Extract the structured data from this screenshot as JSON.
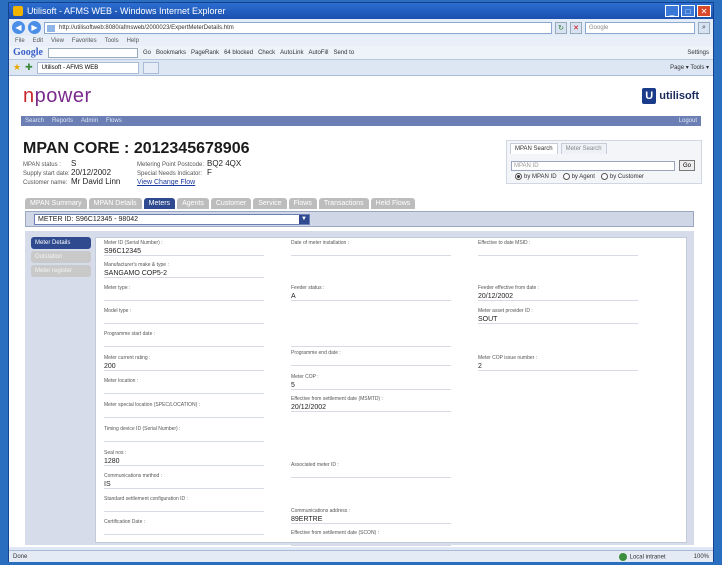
{
  "browser": {
    "title": "Utilisoft - AFMS WEB - Windows Internet Explorer",
    "url": "http://utilisoftweb:8080/afmsweb/2000023/ExpertMeterDetails.htm",
    "live_search_placeholder": "Google",
    "menus": [
      "File",
      "Edit",
      "View",
      "Favorites",
      "Tools",
      "Help"
    ],
    "google_label": "Google",
    "google_items": [
      "Go",
      "Bookmarks",
      "PageRank",
      "64 blocked",
      "Check",
      "AutoLink",
      "AutoFill",
      "Send to"
    ],
    "settings_label": "Settings",
    "tab_label": "Utilisoft - AFMS WEB",
    "toolbar_right": "Page ▾   Tools ▾",
    "status_left": "Done",
    "status_zone": "Local intranet",
    "status_zoom": "100%"
  },
  "brand": {
    "name_left": "n",
    "name_right": "power",
    "partner": "utilisoft",
    "partner_initial": "U"
  },
  "appnav": {
    "items": [
      "Search",
      "Reports",
      "Admin",
      "Flows"
    ],
    "logout": "Logout"
  },
  "mpan": {
    "title": "MPAN CORE : 2012345678906",
    "status_label": "MPAN status :",
    "status_value": "S",
    "supply_label": "Supply start date:",
    "supply_value": "20/12/2002",
    "customer_label": "Customer name:",
    "customer_value": "Mr David Linn",
    "mp_address_label": "Metering Point Postcode:",
    "mp_address_value": "BQ2 4QX",
    "special_label": "Special Needs Indicator:",
    "special_value": "F",
    "change_link": "View Change Flow"
  },
  "search": {
    "tab_active": "MPAN Search",
    "tab_other": "Meter Search",
    "placeholder": "MPAN ID",
    "go": "Go",
    "radio1": "by MPAN ID",
    "radio2": "by Agent",
    "radio3": "by Customer"
  },
  "tabs": [
    "MPAN Summary",
    "MPAN Details",
    "Meters",
    "Agents",
    "Customer",
    "Service",
    "Flows",
    "Transactions",
    "Held Flows"
  ],
  "active_tab_index": 2,
  "meter_select": "METER ID: S96C12345 - 98042",
  "side": {
    "items": [
      "Meter Details",
      "Outstation",
      "Meter register"
    ]
  },
  "fields": {
    "col1": [
      {
        "label": "Meter ID (Serial Number) :",
        "value": "S96C12345"
      },
      {
        "label": "Manufacturer's make & type :",
        "value": "SANGAMO COP5-2"
      },
      {
        "label": "Meter type :",
        "value": ""
      },
      {
        "label": "Model type :",
        "value": ""
      },
      {
        "label": "Programme start date :",
        "value": ""
      },
      {
        "label": "Meter current rating :",
        "value": "200"
      },
      {
        "label": "Meter location :",
        "value": ""
      },
      {
        "label": "Meter special location (SPEC/LOCATION) :",
        "value": ""
      },
      {
        "label": "Timing device ID (Serial Number) :",
        "value": ""
      },
      {
        "label": "Seal nos :",
        "value": "1280"
      },
      {
        "label": "Communications method :",
        "value": "IS"
      },
      {
        "label": "Standard settlement configuration ID :",
        "value": ""
      },
      {
        "label": "Certification Date :",
        "value": ""
      }
    ],
    "col2": [
      {
        "label": "Date of meter installation :",
        "value": ""
      },
      {
        "label": "Feeder status :",
        "value": "A"
      },
      {
        "label": "",
        "value": ""
      },
      {
        "label": "Programme end date :",
        "value": ""
      },
      {
        "label": "Meter COP :",
        "value": "5"
      },
      {
        "label": "Effective from settlement date (MSMTD) :",
        "value": "20/12/2002"
      },
      {
        "label": "Associated meter ID :",
        "value": ""
      },
      {
        "label": "Communications address :",
        "value": "89ERTRE"
      },
      {
        "label": "Effective from settlement date (SCON) :",
        "value": ""
      }
    ],
    "col3": [
      {
        "label": "Effective to date MSID :",
        "value": ""
      },
      {
        "label": "Feeder effective from date :",
        "value": "20/12/2002"
      },
      {
        "label": "Meter asset provider ID :",
        "value": "SOUT"
      },
      {
        "label": "Meter COP issue number :",
        "value": "2"
      }
    ]
  }
}
